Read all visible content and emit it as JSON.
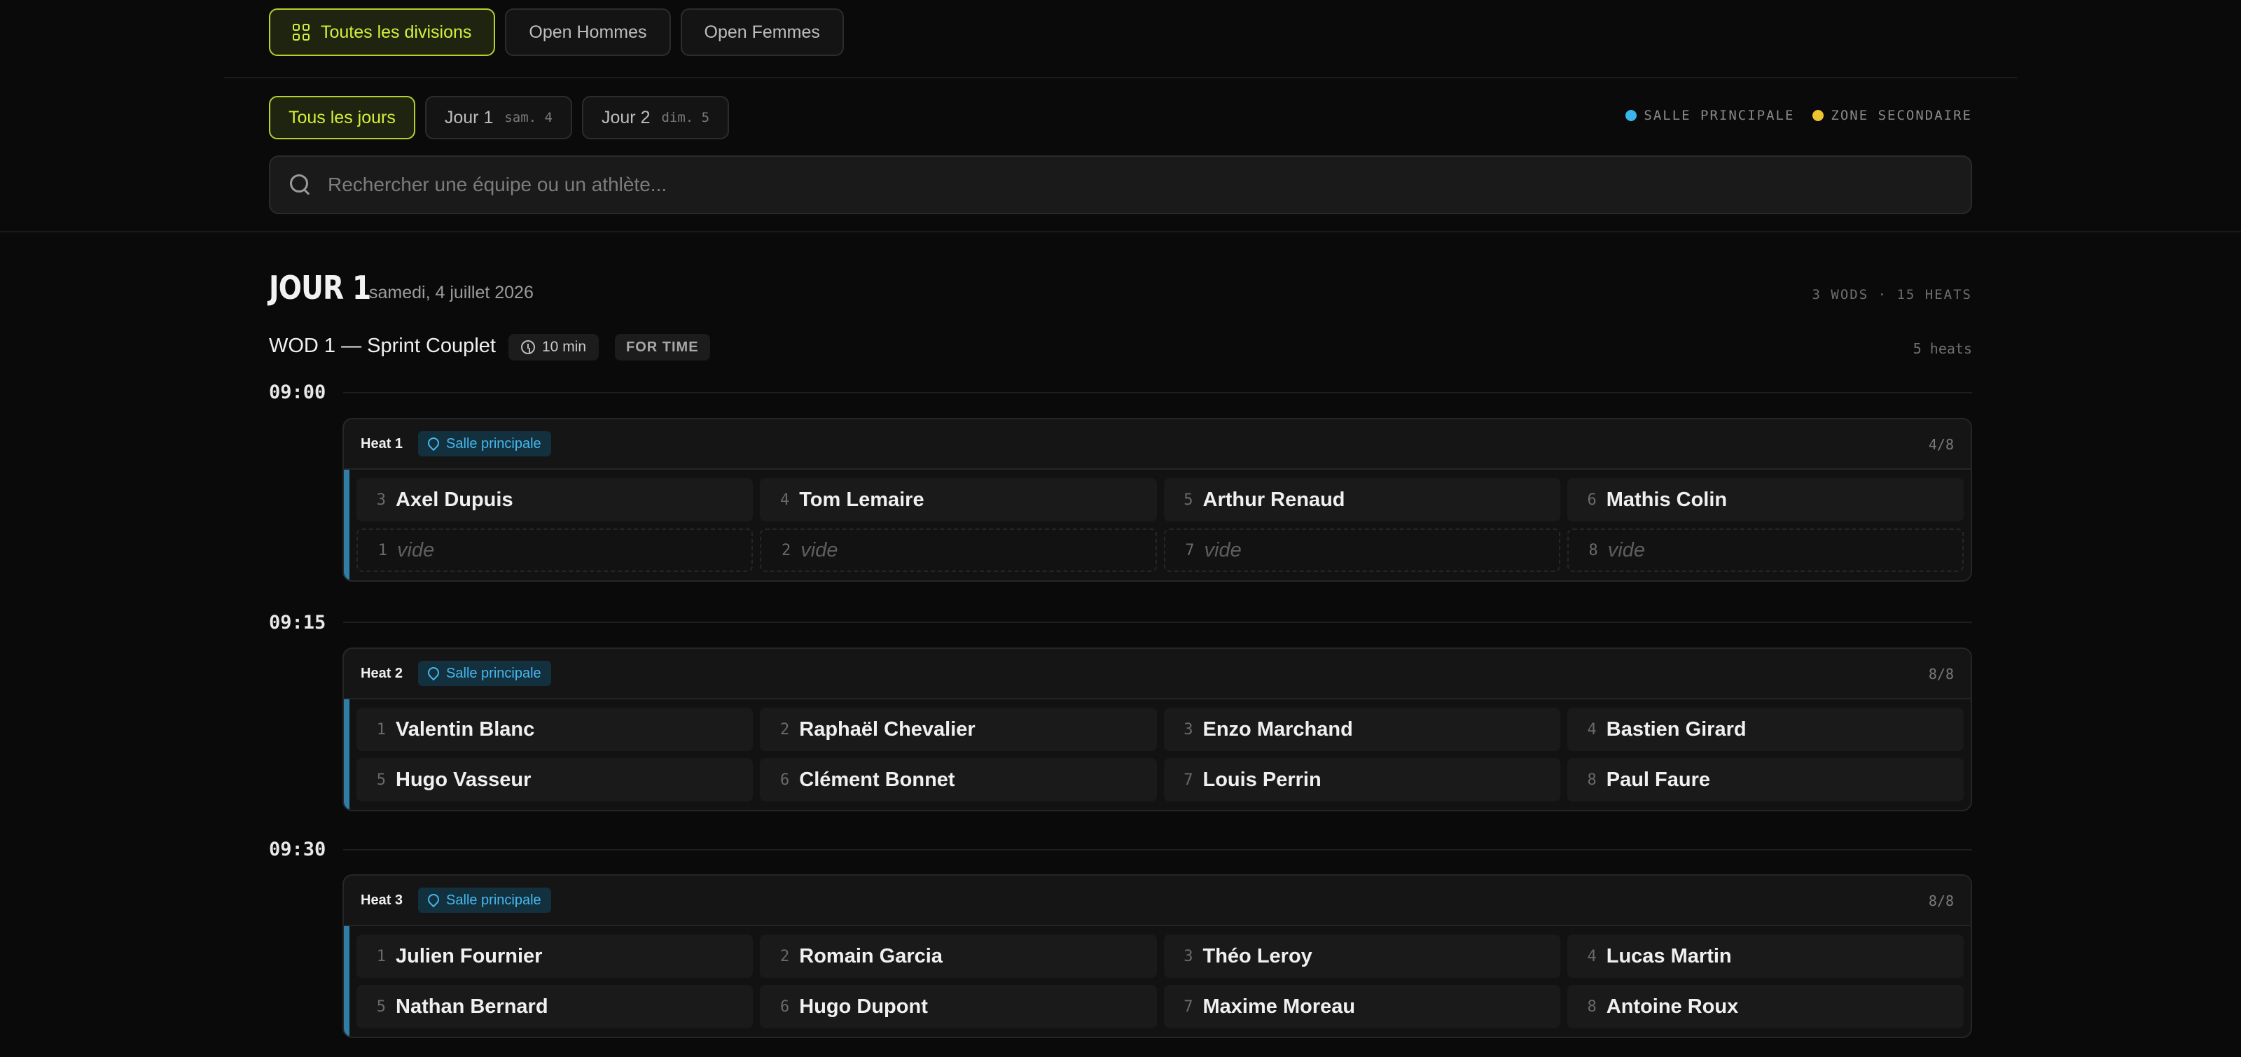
{
  "divisions": [
    {
      "label": "Toutes les divisions",
      "active": true
    },
    {
      "label": "Open Hommes",
      "active": false
    },
    {
      "label": "Open Femmes",
      "active": false
    }
  ],
  "days": [
    {
      "label": "Tous les jours",
      "sub": "",
      "active": true
    },
    {
      "label": "Jour 1",
      "sub": "sam. 4",
      "active": false
    },
    {
      "label": "Jour 2",
      "sub": "dim. 5",
      "active": false
    }
  ],
  "legend": [
    {
      "label": "SALLE PRINCIPALE",
      "color": "#38b6ec"
    },
    {
      "label": "ZONE SECONDAIRE",
      "color": "#f0c431"
    }
  ],
  "search": {
    "placeholder": "Rechercher une équipe ou un athlète..."
  },
  "day": {
    "title": "JOUR 1",
    "date": "samedi, 4 juillet 2026",
    "meta": "3 WODS · 15 HEATS"
  },
  "wod": {
    "title": "WOD 1 — Sprint Couplet",
    "duration": "10 min",
    "type": "FOR TIME",
    "heats": "5 heats"
  },
  "schedule": [
    {
      "time": "09:00",
      "heat": "Heat 1",
      "venue": "Salle principale",
      "count": "4/8",
      "lanes": [
        {
          "lane": "3",
          "name": "Axel Dupuis",
          "empty": false
        },
        {
          "lane": "4",
          "name": "Tom Lemaire",
          "empty": false
        },
        {
          "lane": "5",
          "name": "Arthur Renaud",
          "empty": false
        },
        {
          "lane": "6",
          "name": "Mathis Colin",
          "empty": false
        },
        {
          "lane": "1",
          "name": "vide",
          "empty": true
        },
        {
          "lane": "2",
          "name": "vide",
          "empty": true
        },
        {
          "lane": "7",
          "name": "vide",
          "empty": true
        },
        {
          "lane": "8",
          "name": "vide",
          "empty": true
        }
      ]
    },
    {
      "time": "09:15",
      "heat": "Heat 2",
      "venue": "Salle principale",
      "count": "8/8",
      "lanes": [
        {
          "lane": "1",
          "name": "Valentin Blanc",
          "empty": false
        },
        {
          "lane": "2",
          "name": "Raphaël Chevalier",
          "empty": false
        },
        {
          "lane": "3",
          "name": "Enzo Marchand",
          "empty": false
        },
        {
          "lane": "4",
          "name": "Bastien Girard",
          "empty": false
        },
        {
          "lane": "5",
          "name": "Hugo Vasseur",
          "empty": false
        },
        {
          "lane": "6",
          "name": "Clément Bonnet",
          "empty": false
        },
        {
          "lane": "7",
          "name": "Louis Perrin",
          "empty": false
        },
        {
          "lane": "8",
          "name": "Paul Faure",
          "empty": false
        }
      ]
    },
    {
      "time": "09:30",
      "heat": "Heat 3",
      "venue": "Salle principale",
      "count": "8/8",
      "lanes": [
        {
          "lane": "1",
          "name": "Julien Fournier",
          "empty": false
        },
        {
          "lane": "2",
          "name": "Romain Garcia",
          "empty": false
        },
        {
          "lane": "3",
          "name": "Théo Leroy",
          "empty": false
        },
        {
          "lane": "4",
          "name": "Lucas Martin",
          "empty": false
        },
        {
          "lane": "5",
          "name": "Nathan Bernard",
          "empty": false
        },
        {
          "lane": "6",
          "name": "Hugo Dupont",
          "empty": false
        },
        {
          "lane": "7",
          "name": "Maxime Moreau",
          "empty": false
        },
        {
          "lane": "8",
          "name": "Antoine Roux",
          "empty": false
        }
      ]
    }
  ]
}
